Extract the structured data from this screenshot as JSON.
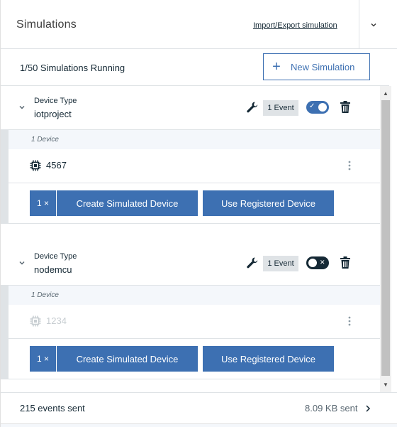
{
  "header": {
    "title": "Simulations",
    "import_export_label": "Import/Export simulation"
  },
  "status": {
    "running_text": "1/50 Simulations Running",
    "new_simulation_label": "New Simulation"
  },
  "device_types": [
    {
      "type_label": "Device Type",
      "name": "iotproject",
      "event_badge": "1 Event",
      "enabled": true,
      "toggle_mark": "✓",
      "device_count_label": "1 Device",
      "devices": [
        {
          "id": "4567",
          "muted": false
        }
      ],
      "quantity_label": "1 ×",
      "create_label": "Create Simulated Device",
      "register_label": "Use Registered Device"
    },
    {
      "type_label": "Device Type",
      "name": "nodemcu",
      "event_badge": "1 Event",
      "enabled": false,
      "toggle_mark": "✕",
      "device_count_label": "1 Device",
      "devices": [
        {
          "id": "1234",
          "muted": true
        }
      ],
      "quantity_label": "1 ×",
      "create_label": "Create Simulated Device",
      "register_label": "Use Registered Device"
    }
  ],
  "footer": {
    "events_sent": "215 events sent",
    "size_sent": "8.09 KB sent"
  },
  "colors": {
    "accent": "#3d70b2",
    "text": "#152935",
    "border": "#dfe3e6",
    "toggle_off": "#152935"
  }
}
